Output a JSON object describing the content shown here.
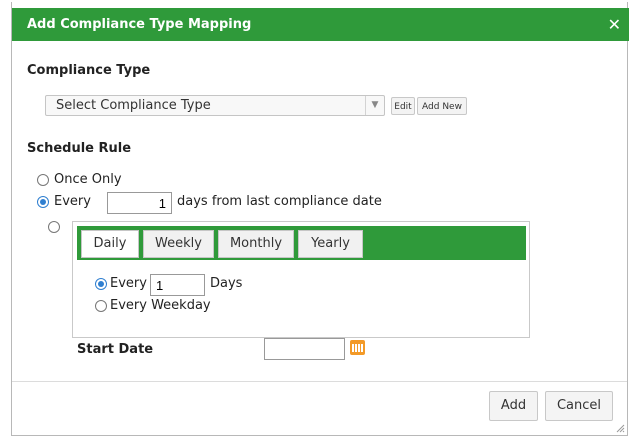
{
  "dialog": {
    "title": "Add Compliance Type Mapping",
    "close_glyph": "✕"
  },
  "compliance": {
    "label": "Compliance Type",
    "select_value": "Select Compliance Type",
    "edit_label": "Edit",
    "add_new_label": "Add New"
  },
  "schedule": {
    "label": "Schedule Rule",
    "option_once": "Once Only",
    "option_every": "Every",
    "every_days_value": "1",
    "every_suffix": "days from last compliance date",
    "tabs": [
      "Daily",
      "Weekly",
      "Monthly",
      "Yearly"
    ],
    "active_tab": "Daily",
    "daily_every_label": "Every",
    "daily_every_value": "1",
    "daily_days_label": "Days",
    "daily_weekday_label": "Every Weekday",
    "selected_option": "every"
  },
  "start_date": {
    "label": "Start Date",
    "value": ""
  },
  "footer": {
    "add_label": "Add",
    "cancel_label": "Cancel"
  },
  "colors": {
    "header": "#2f9a3a",
    "radio_selected": "#2f7fd0",
    "calendar_icon": "#f39a28"
  },
  "icons": [
    "close-icon",
    "dropdown-arrow-icon",
    "calendar-icon",
    "resize-grip-icon"
  ]
}
